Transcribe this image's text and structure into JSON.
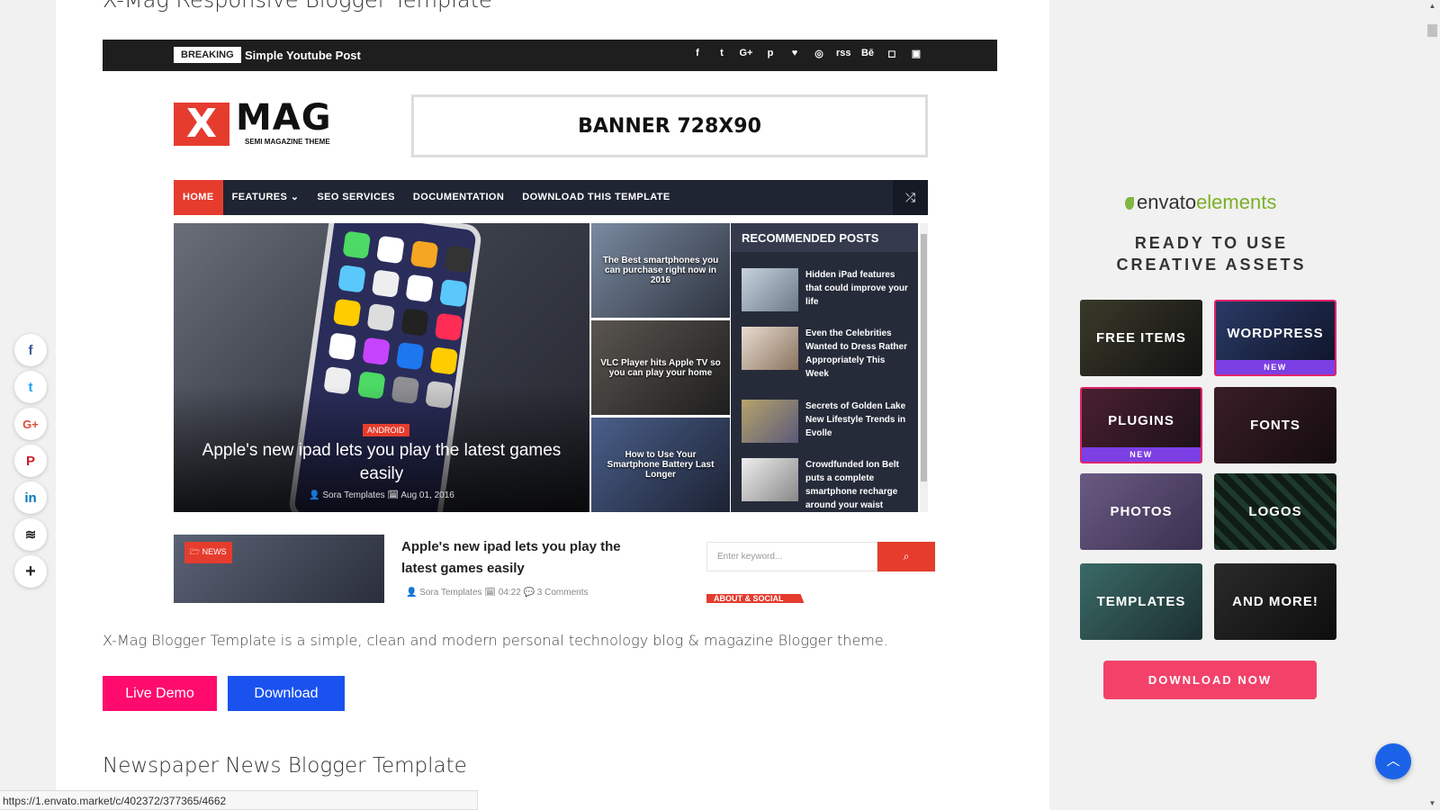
{
  "article": {
    "title_top": "X-Mag Responsive Blogger Template",
    "description": "X-Mag Blogger Template is a simple, clean and modern personal technology blog & magazine Blogger theme.",
    "live_demo": "Live Demo",
    "download": "Download",
    "next_title": "Newspaper News Blogger Template"
  },
  "preview": {
    "breaking_label": "BREAKING",
    "breaking_text": "Simple Youtube Post",
    "social_icons": [
      "f",
      "t",
      "G+",
      "p",
      "♥",
      "◎",
      "rss",
      "Bē",
      "◻",
      "▣"
    ],
    "logo_x": "X",
    "logo_mag": "MAG",
    "logo_sub": "SEMI MAGAZINE THEME",
    "banner": "BANNER 728X90",
    "nav": [
      "HOME",
      "FEATURES ⌄",
      "SEO SERVICES",
      "DOCUMENTATION",
      "DOWNLOAD THIS TEMPLATE"
    ],
    "hero": {
      "tag": "ANDROID",
      "title": "Apple's new ipad lets you play the latest games easily",
      "meta": "👤 Sora Templates   🗓 Aug 01, 2016"
    },
    "tiles": [
      "The Best smartphones you can purchase right now in 2016",
      "VLC Player hits Apple TV so you can play your home",
      "How to Use Your Smartphone Battery Last Longer"
    ],
    "recommended_title": "RECOMMENDED POSTS",
    "recommended": [
      "Hidden iPad features that could improve your life",
      "Even the Celebrities Wanted to Dress Rather Appropriately This Week",
      "Secrets of Golden Lake New Lifestyle Trends in Evolle",
      "Crowdfunded Ion Belt puts a complete smartphone recharge around your waist"
    ],
    "news_tag": "🗁 NEWS",
    "news_title": "Apple's new ipad lets you play the latest games easily",
    "news_meta": "👤 Sora Templates   🗓 04:22   💬 3 Comments",
    "search_placeholder": "Enter keyword...",
    "about_label": "ABOUT & SOCIAL"
  },
  "share_icons": [
    "f",
    "t",
    "G+",
    "P",
    "in",
    "≋",
    "+"
  ],
  "ad": {
    "brand": "envato",
    "brand_suffix": "elements",
    "headline_1": "READY TO USE",
    "headline_2": "CREATIVE ASSETS",
    "tiles": [
      {
        "label": "FREE ITEMS",
        "tag": ""
      },
      {
        "label": "WORDPRESS",
        "tag": "NEW"
      },
      {
        "label": "PLUGINS",
        "tag": "NEW"
      },
      {
        "label": "FONTS",
        "tag": ""
      },
      {
        "label": "PHOTOS",
        "tag": ""
      },
      {
        "label": "LOGOS",
        "tag": ""
      },
      {
        "label": "TEMPLATES",
        "tag": ""
      },
      {
        "label": "AND MORE!",
        "tag": ""
      }
    ],
    "cta": "DOWNLOAD NOW"
  },
  "status_url": "https://1.envato.market/c/402372/377365/4662",
  "colors": {
    "accent_red": "#e53c2e",
    "live_demo": "#ff0b6d",
    "download": "#1a52f0",
    "envato_green": "#82b541",
    "envato_cta": "#f2426a",
    "envato_purple": "#7b3fe4"
  }
}
